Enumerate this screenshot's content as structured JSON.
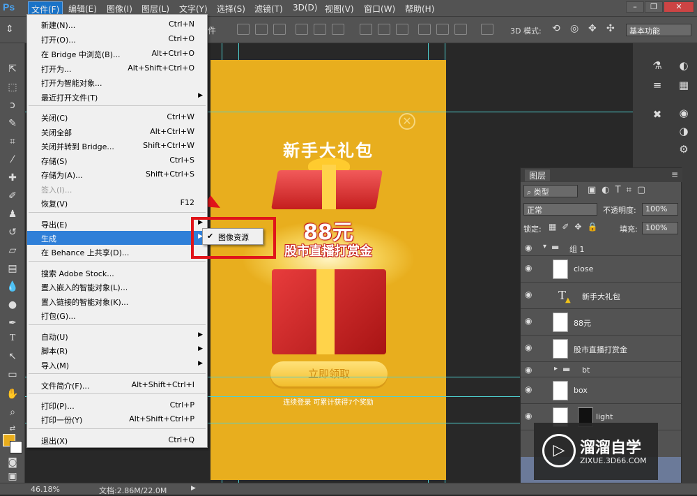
{
  "app": {
    "logo": "Ps"
  },
  "menubar": {
    "items": [
      "文件(F)",
      "编辑(E)",
      "图像(I)",
      "图层(L)",
      "文字(Y)",
      "选择(S)",
      "滤镜(T)",
      "3D(D)",
      "视图(V)",
      "窗口(W)",
      "帮助(H)"
    ]
  },
  "options": {
    "mode3d": "3D 模式:",
    "workspace": "基本功能",
    "partial_label": "件"
  },
  "file_menu": {
    "items": [
      {
        "label": "新建(N)...",
        "shortcut": "Ctrl+N"
      },
      {
        "label": "打开(O)...",
        "shortcut": "Ctrl+O"
      },
      {
        "label": "在 Bridge 中浏览(B)...",
        "shortcut": "Alt+Ctrl+O"
      },
      {
        "label": "打开为...",
        "shortcut": "Alt+Shift+Ctrl+O"
      },
      {
        "label": "打开为智能对象...",
        "shortcut": ""
      },
      {
        "label": "最近打开文件(T)",
        "shortcut": ""
      },
      {
        "label": "关闭(C)",
        "shortcut": "Ctrl+W"
      },
      {
        "label": "关闭全部",
        "shortcut": "Alt+Ctrl+W"
      },
      {
        "label": "关闭并转到 Bridge...",
        "shortcut": "Shift+Ctrl+W"
      },
      {
        "label": "存储(S)",
        "shortcut": "Ctrl+S"
      },
      {
        "label": "存储为(A)...",
        "shortcut": "Shift+Ctrl+S"
      },
      {
        "label": "签入(I)...",
        "shortcut": ""
      },
      {
        "label": "恢复(V)",
        "shortcut": "F12"
      },
      {
        "label": "导出(E)",
        "shortcut": ""
      },
      {
        "label": "生成",
        "shortcut": ""
      },
      {
        "label": "在 Behance 上共享(D)...",
        "shortcut": ""
      },
      {
        "label": "搜索 Adobe Stock...",
        "shortcut": ""
      },
      {
        "label": "置入嵌入的智能对象(L)...",
        "shortcut": ""
      },
      {
        "label": "置入链接的智能对象(K)...",
        "shortcut": ""
      },
      {
        "label": "打包(G)...",
        "shortcut": ""
      },
      {
        "label": "自动(U)",
        "shortcut": ""
      },
      {
        "label": "脚本(R)",
        "shortcut": ""
      },
      {
        "label": "导入(M)",
        "shortcut": ""
      },
      {
        "label": "文件简介(F)...",
        "shortcut": "Alt+Shift+Ctrl+I"
      },
      {
        "label": "打印(P)...",
        "shortcut": "Ctrl+P"
      },
      {
        "label": "打印一份(Y)",
        "shortcut": "Alt+Shift+Ctrl+P"
      },
      {
        "label": "退出(X)",
        "shortcut": "Ctrl+Q"
      }
    ],
    "submenu": {
      "item": "图像资源",
      "checked": true
    }
  },
  "canvas": {
    "title": "新手大礼包",
    "amount": "88元",
    "subtitle": "股市直播打赏金",
    "button": "立即领取",
    "hint": "连续登录 可累计获得7个奖励",
    "close_glyph": "✕"
  },
  "layers_panel": {
    "tab": "图层",
    "filter": "类型",
    "blend_mode": "正常",
    "opacity_label": "不透明度:",
    "opacity": "100%",
    "lock_label": "锁定:",
    "fill_label": "填充:",
    "fill": "100%",
    "layers": [
      "组 1",
      "close",
      "新手大礼包",
      "88元",
      "股市直播打赏金",
      "bt",
      "box",
      "light"
    ]
  },
  "status": {
    "zoom": "46.18%",
    "doc": "文档:2.86M/22.0M"
  },
  "watermark": {
    "title": "溜溜自学",
    "url": "ZIXUE.3D66.COM"
  },
  "colors": {
    "foreground": "#e9ad1c",
    "background": "#ffffff",
    "canvas_bg": "#e8ae1e",
    "highlight": "#2f7fd8",
    "annotation": "#e0141a"
  }
}
